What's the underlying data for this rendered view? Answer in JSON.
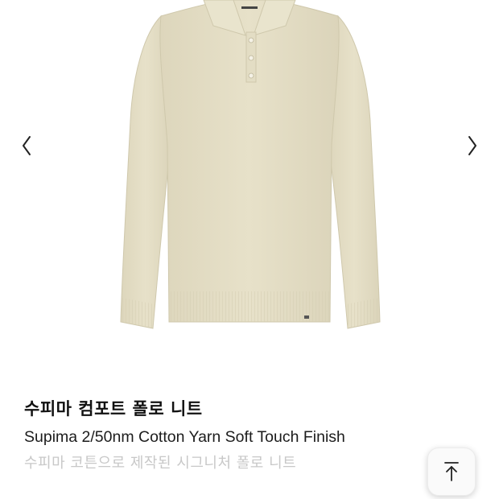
{
  "gallery": {
    "image_icon": "knit-polo-sweater-image",
    "prev_icon": "chevron-left-icon",
    "next_icon": "chevron-right-icon"
  },
  "product": {
    "title": "수피마 컴포트 폴로 니트",
    "subtitle": "Supima 2/50nm Cotton Yarn Soft Touch Finish",
    "description": "수피마 코튼으로 제작된 시그니처 폴로 니트"
  },
  "scroll_top": {
    "icon": "arrow-up-to-top-icon"
  },
  "colors": {
    "sweater": "#e6e0c8",
    "description_text": "#c8c8c8",
    "title_text": "#111111"
  }
}
